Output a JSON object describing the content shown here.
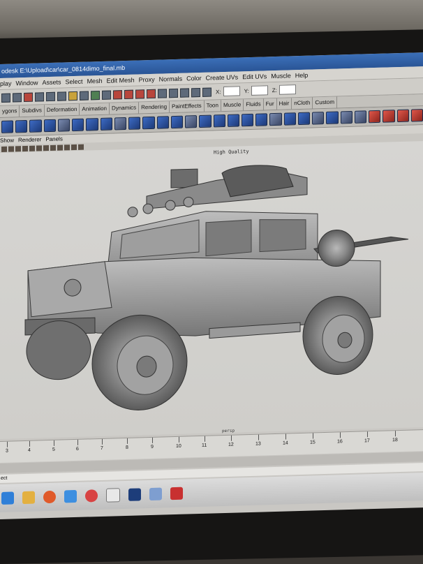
{
  "window": {
    "title": "odesk E:\\Upload\\car\\car_0814dimo_final.mb"
  },
  "menu": [
    "play",
    "Window",
    "Assets",
    "Select",
    "Mesh",
    "Edit Mesh",
    "Proxy",
    "Normals",
    "Color",
    "Create UVs",
    "Edit UVs",
    "Muscle",
    "Help"
  ],
  "status": {
    "x_label": "X:",
    "y_label": "Y:",
    "z_label": "Z:"
  },
  "shelf_tabs": [
    "ygons",
    "Subdivs",
    "Deformation",
    "Animation",
    "Dynamics",
    "Rendering",
    "PaintEffects",
    "Toon",
    "Muscle",
    "Fluids",
    "Fur",
    "Hair",
    "nCloth",
    "Custom"
  ],
  "panel_menu": [
    "Show",
    "Renderer",
    "Panels"
  ],
  "viewport": {
    "hud_quality": "High Quality",
    "camera_label": "persp"
  },
  "timeline": {
    "ticks": [
      "3",
      "4",
      "5",
      "6",
      "7",
      "8",
      "9",
      "10",
      "11",
      "12",
      "13",
      "14",
      "15",
      "16",
      "17",
      "18"
    ]
  },
  "command_line": {
    "label": "ect"
  },
  "taskbar_apps": [
    "ie-icon",
    "folder-icon",
    "media-player-icon",
    "browser-icon",
    "antivirus-icon",
    "zbrush-icon",
    "photoshop-icon",
    "image-viewer-icon",
    "foxit-icon"
  ],
  "colors": {
    "titlebar": "#2f5fa6",
    "accent_shelf": "#2f59b6"
  }
}
